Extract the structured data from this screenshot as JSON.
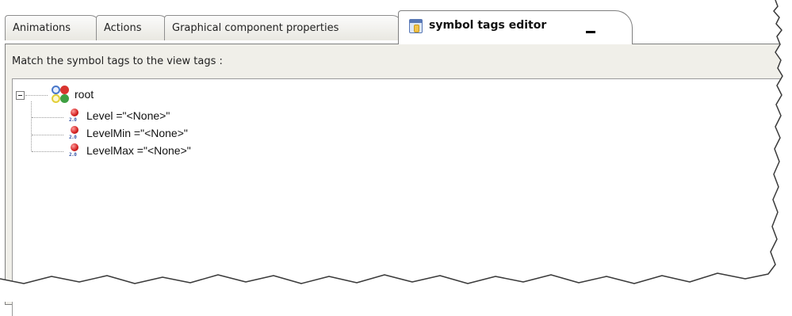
{
  "tabs": [
    {
      "label": "Animations"
    },
    {
      "label": "Actions"
    },
    {
      "label": "Graphical component properties"
    },
    {
      "label": "symbol tags editor",
      "active": true
    }
  ],
  "panel": {
    "header": "Match the symbol tags to the view tags :"
  },
  "tree": {
    "root": {
      "label": "root",
      "icon": "group-circles-icon",
      "expanded": true
    },
    "children": [
      {
        "label": "Level =\"<None>\"",
        "icon": "tag-ball-icon",
        "icon_badge": "2.0"
      },
      {
        "label": "LevelMin =\"<None>\"",
        "icon": "tag-ball-icon",
        "icon_badge": "2.0"
      },
      {
        "label": "LevelMax =\"<None>\"",
        "icon": "tag-ball-icon",
        "icon_badge": "2.0"
      }
    ]
  },
  "colors": {
    "panel_bg": "#f0efe9",
    "border": "#7f7f7f",
    "tag_icon_red": "#d21f1f"
  }
}
